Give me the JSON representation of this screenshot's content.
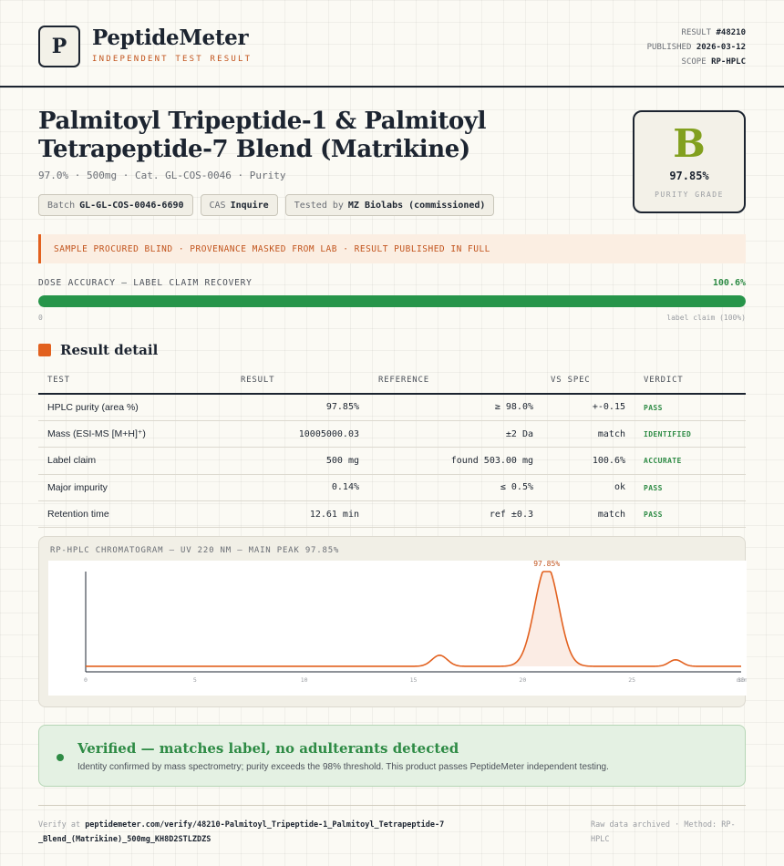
{
  "header": {
    "logo_letter": "P",
    "brand": "PeptideMeter",
    "brand_sub": "INDEPENDENT TEST RESULT",
    "result_label": "RESULT",
    "result_value": "#48210",
    "published_label": "PUBLISHED",
    "published_value": "2026-03-12",
    "scope_label": "SCOPE",
    "scope_value": "RP-HPLC"
  },
  "product": {
    "title": "Palmitoyl Tripeptide-1 & Palmitoyl Tetrapeptide-7 Blend (Matrikine)",
    "subline": "97.0% · 500mg · Cat. GL-COS-0046 · Purity",
    "chips": [
      {
        "label": "Batch",
        "value": "GL-GL-COS-0046-6690"
      },
      {
        "label": "CAS",
        "value": "Inquire"
      },
      {
        "label": "Tested by",
        "value": "MZ Biolabs (commissioned)"
      }
    ]
  },
  "grade": {
    "letter": "B",
    "percent": "97.85%",
    "label": "PURITY GRADE",
    "color": "#82a01e"
  },
  "notice": "SAMPLE PROCURED BLIND · PROVENANCE MASKED FROM LAB · RESULT PUBLISHED IN FULL",
  "dose": {
    "label": "DOSE ACCURACY — LABEL CLAIM RECOVERY",
    "value": "100.6%",
    "fill_fraction": 1.0,
    "min_label": "0",
    "max_label": "label claim (100%)",
    "color": "#27954a"
  },
  "detail": {
    "section_title": "Result detail",
    "columns": [
      "TEST",
      "RESULT",
      "REFERENCE",
      "VS SPEC",
      "VERDICT"
    ],
    "rows": [
      {
        "test": "HPLC purity (area %)",
        "result": "97.85%",
        "reference": "≥ 98.0%",
        "vs_spec": "+-0.15",
        "verdict": "PASS"
      },
      {
        "test": "Mass (ESI-MS [M+H]⁺)",
        "result": "10005000.03",
        "reference": "±2 Da",
        "vs_spec": "match",
        "verdict": "IDENTIFIED"
      },
      {
        "test": "Label claim",
        "result": "500 mg",
        "reference": "found 503.00 mg",
        "vs_spec": "100.6%",
        "verdict": "ACCURATE"
      },
      {
        "test": "Major impurity",
        "result": "0.14%",
        "reference": "≤ 0.5%",
        "vs_spec": "ok",
        "verdict": "PASS"
      },
      {
        "test": "Retention time",
        "result": "12.61 min",
        "reference": "ref ±0.3",
        "vs_spec": "match",
        "verdict": "PASS"
      }
    ]
  },
  "chart_data": {
    "type": "line",
    "title": "RP-HPLC CHROMATOGRAM — UV 220 NM — MAIN PEAK 97.85%",
    "xlabel": "",
    "ylabel": "",
    "xlim": [
      0,
      30
    ],
    "ylim": [
      0,
      1
    ],
    "x_ticks": [
      "0",
      "5",
      "10",
      "15",
      "20",
      "25",
      "30"
    ],
    "x_tick_last_suffix": "min",
    "baseline": 0.055,
    "peaks": [
      {
        "rt": 16.2,
        "height": 0.11,
        "width": 0.35
      },
      {
        "rt": 21.1,
        "height": 1.0,
        "width": 0.55
      },
      {
        "rt": 27.0,
        "height": 0.065,
        "width": 0.3
      }
    ],
    "main_peak_label": "97.85%",
    "line_color": "#e2611f",
    "grid": false
  },
  "verified": {
    "title": "Verified — matches label, no adulterants detected",
    "description": "Identity confirmed by mass spectrometry; purity exceeds the 98% threshold. This product passes PeptideMeter independent testing."
  },
  "footer": {
    "verify_prefix": "Verify at",
    "verify_url": "peptidemeter.com/verify/48210-Palmitoyl_Tripeptide-1_Palmitoyl_Tetrapeptide-7_Blend_(Matrikine)_500mg_KH8D2STLZDZS",
    "archive": "Raw data archived · Method: RP-HPLC"
  }
}
